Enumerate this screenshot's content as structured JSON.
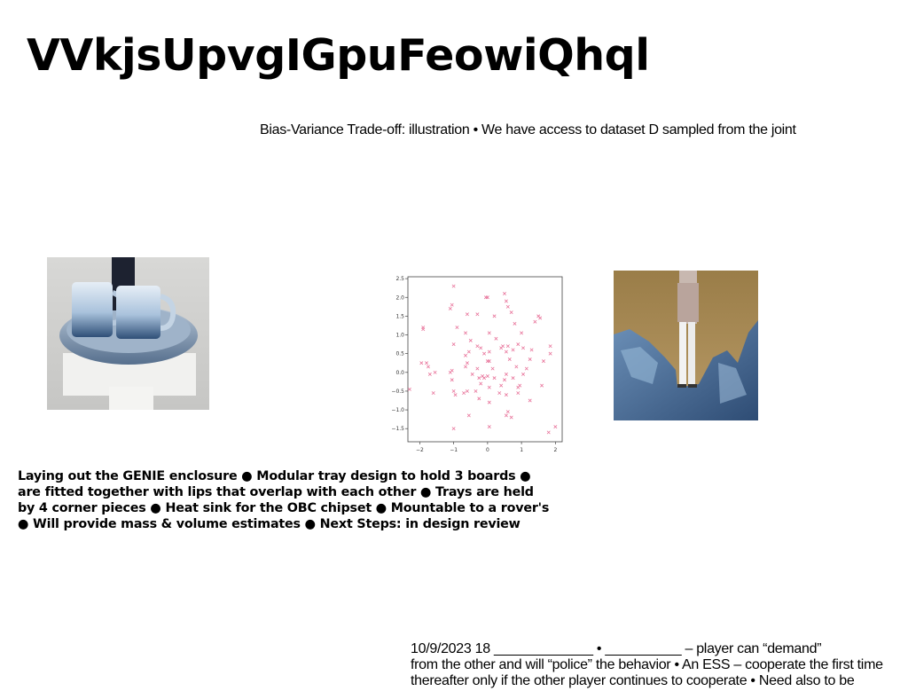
{
  "title": "VVkjsUpvgIGpuFeowiQhql",
  "subtitle": "Bias-Variance Trade-off: illustration • We have access to dataset D sampled from the joint",
  "body_lines": [
    "Laying out the GENIE enclosure ● Modular tray design to hold 3 boards ●",
    "are fitted together with lips that overlap with each other ● Trays are held",
    "by 4 corner pieces ● Heat sink for the OBC chipset ● Mountable to a rover's",
    "● Will provide mass & volume estimates ● Next Steps: in design review"
  ],
  "footer_lines": [
    "10/9/2023 18 _____________ • __________ – player can “demand”",
    "from the other  and will “police” the behavior • An ESS – cooperate the first time",
    "thereafter only if the other player continues to cooperate • Need also to be"
  ],
  "colors": {
    "marker": "#e8739a",
    "axis": "#444444"
  },
  "chart_data": {
    "type": "scatter",
    "marker": "x",
    "xlim": [
      -2.35,
      2.2
    ],
    "ylim": [
      -1.85,
      2.55
    ],
    "x_ticks": [
      -2,
      -1,
      0,
      1,
      2
    ],
    "y_ticks": [
      -1.5,
      -1.0,
      -0.5,
      0.0,
      0.5,
      1.0,
      1.5,
      2.0,
      2.5
    ],
    "x_tick_labels": [
      "−2",
      "−1",
      "0",
      "1",
      "2"
    ],
    "y_tick_labels": [
      "−1.5",
      "−1.0",
      "−0.5",
      "0.0",
      "0.5",
      "1.0",
      "1.5",
      "2.0",
      "2.5"
    ],
    "points": [
      [
        -1.0,
        2.3
      ],
      [
        -0.05,
        2.0
      ],
      [
        0.0,
        2.0
      ],
      [
        0.5,
        2.1
      ],
      [
        0.55,
        1.9
      ],
      [
        -1.05,
        1.8
      ],
      [
        -1.1,
        1.7
      ],
      [
        0.6,
        1.75
      ],
      [
        1.5,
        1.5
      ],
      [
        1.55,
        1.45
      ],
      [
        -0.6,
        1.55
      ],
      [
        -1.9,
        1.2
      ],
      [
        -0.3,
        1.55
      ],
      [
        -0.9,
        1.2
      ],
      [
        0.2,
        1.5
      ],
      [
        0.7,
        1.6
      ],
      [
        1.4,
        1.35
      ],
      [
        -0.65,
        1.05
      ],
      [
        -1.9,
        1.15
      ],
      [
        0.05,
        1.05
      ],
      [
        0.8,
        1.3
      ],
      [
        -0.5,
        0.85
      ],
      [
        0.25,
        0.9
      ],
      [
        1.0,
        1.05
      ],
      [
        -0.2,
        0.65
      ],
      [
        -0.3,
        0.7
      ],
      [
        0.4,
        0.65
      ],
      [
        0.45,
        0.7
      ],
      [
        0.6,
        0.7
      ],
      [
        0.9,
        0.75
      ],
      [
        1.05,
        0.65
      ],
      [
        1.85,
        0.7
      ],
      [
        -1.0,
        0.75
      ],
      [
        -0.55,
        0.55
      ],
      [
        0.05,
        0.55
      ],
      [
        0.55,
        0.55
      ],
      [
        0.75,
        0.6
      ],
      [
        1.3,
        0.6
      ],
      [
        1.85,
        0.5
      ],
      [
        -0.1,
        0.5
      ],
      [
        -0.65,
        0.45
      ],
      [
        1.25,
        0.35
      ],
      [
        -1.95,
        0.25
      ],
      [
        -1.8,
        0.25
      ],
      [
        -0.6,
        0.25
      ],
      [
        0.0,
        0.3
      ],
      [
        0.05,
        0.3
      ],
      [
        0.65,
        0.35
      ],
      [
        1.65,
        0.3
      ],
      [
        -1.75,
        0.15
      ],
      [
        -1.05,
        0.05
      ],
      [
        -0.3,
        0.1
      ],
      [
        -0.65,
        0.15
      ],
      [
        0.15,
        0.1
      ],
      [
        0.85,
        0.15
      ],
      [
        1.15,
        0.1
      ],
      [
        -1.55,
        -0.0
      ],
      [
        -1.7,
        -0.05
      ],
      [
        -1.1,
        0.0
      ],
      [
        -0.45,
        -0.05
      ],
      [
        -0.25,
        -0.15
      ],
      [
        0.0,
        -0.1
      ],
      [
        0.2,
        -0.15
      ],
      [
        -0.1,
        -0.15
      ],
      [
        -0.15,
        -0.1
      ],
      [
        0.55,
        -0.05
      ],
      [
        0.5,
        -0.2
      ],
      [
        0.75,
        -0.15
      ],
      [
        1.05,
        -0.05
      ],
      [
        -1.05,
        -0.2
      ],
      [
        -0.2,
        -0.3
      ],
      [
        0.4,
        -0.35
      ],
      [
        0.95,
        -0.35
      ],
      [
        -2.3,
        -0.45
      ],
      [
        -1.6,
        -0.55
      ],
      [
        -1.0,
        -0.5
      ],
      [
        -0.95,
        -0.6
      ],
      [
        -0.7,
        -0.55
      ],
      [
        -0.6,
        -0.5
      ],
      [
        -0.35,
        -0.5
      ],
      [
        0.05,
        -0.4
      ],
      [
        0.9,
        -0.4
      ],
      [
        1.6,
        -0.35
      ],
      [
        -0.25,
        -0.7
      ],
      [
        0.35,
        -0.55
      ],
      [
        0.55,
        -0.6
      ],
      [
        0.9,
        -0.55
      ],
      [
        0.05,
        -0.8
      ],
      [
        1.25,
        -0.75
      ],
      [
        0.6,
        -1.05
      ],
      [
        0.55,
        -1.15
      ],
      [
        0.7,
        -1.2
      ],
      [
        -0.55,
        -1.15
      ],
      [
        -1.0,
        -1.5
      ],
      [
        0.05,
        -1.45
      ],
      [
        2.0,
        -1.45
      ],
      [
        1.8,
        -1.6
      ]
    ]
  }
}
